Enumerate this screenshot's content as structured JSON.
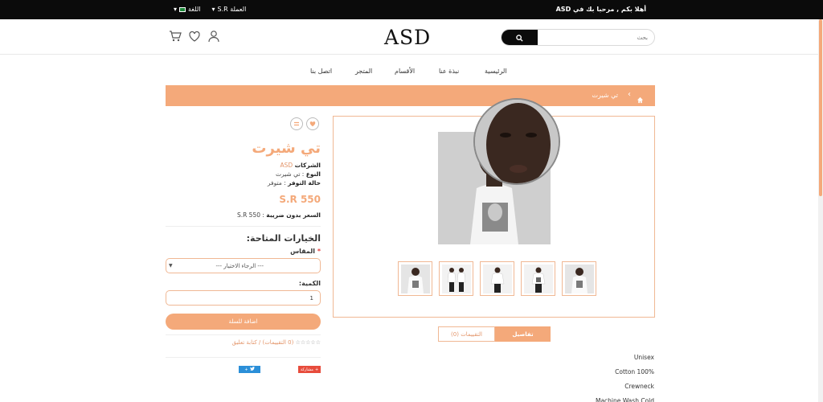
{
  "topbar": {
    "welcome": "أهلا بكم , مرحبا بك في ASD",
    "currency": "S.R العملة",
    "language": "اللغة"
  },
  "header": {
    "logo": "ASD",
    "search_placeholder": "بحث"
  },
  "nav": {
    "items": [
      "الرئيسية",
      "نبذة عنا",
      "الأقسام",
      "المتجر",
      "اتصل بنا"
    ]
  },
  "breadcrumb": {
    "current": "تي شيرت"
  },
  "product": {
    "title": "تي شيرت",
    "brand_label": "الشركات",
    "brand_value": "ASD",
    "type_label": "النوع",
    "type_value": "تي شيرت",
    "availability_label": "حالة التوفر",
    "availability_value": "متوفر",
    "price": "S.R 550",
    "price_ex_tax_label": "السعر بدون ضريبة",
    "price_ex_tax_value": "S.R 550",
    "options_title": "الخيارات المتاحة:",
    "size_label": "المقاس",
    "size_placeholder": "--- الرجاء الاختيار ---",
    "quantity_label": "الكمية:",
    "quantity_value": "1",
    "add_to_cart": "اضافة للسلة",
    "reviews_link": "0 التقييمات",
    "write_review": "كتابة تعليق",
    "share_label": "مشاركة"
  },
  "tabs": {
    "details": "تفاصيل",
    "reviews": "التقييمات (0)"
  },
  "specs": [
    "Unisex",
    "Cotton 100%",
    "Crewneck",
    "Machine Wash Cold"
  ],
  "colors": {
    "accent": "#f4a97a",
    "dark": "#0b0b0b"
  }
}
